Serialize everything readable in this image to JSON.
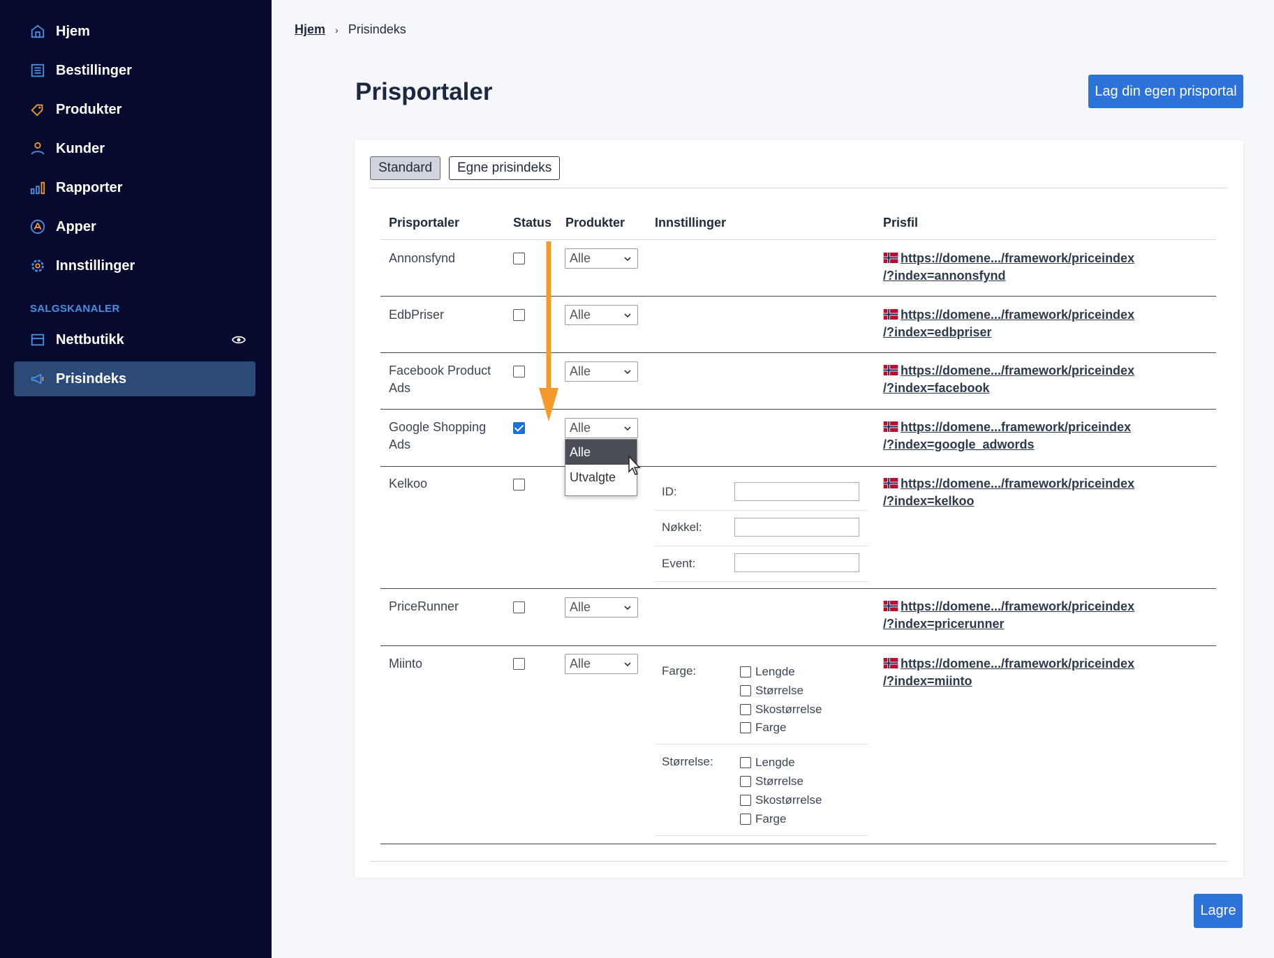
{
  "sidebar": {
    "items": [
      {
        "label": "Hjem",
        "icon": "home-icon"
      },
      {
        "label": "Bestillinger",
        "icon": "orders-icon"
      },
      {
        "label": "Produkter",
        "icon": "tag-icon"
      },
      {
        "label": "Kunder",
        "icon": "user-icon"
      },
      {
        "label": "Rapporter",
        "icon": "bar-chart-icon"
      },
      {
        "label": "Apper",
        "icon": "apps-icon"
      },
      {
        "label": "Innstillinger",
        "icon": "gear-icon"
      }
    ],
    "section_label": "SALGSKANALER",
    "channels": [
      {
        "label": "Nettbutikk",
        "icon": "store-icon"
      },
      {
        "label": "Prisindeks",
        "icon": "megaphone-icon"
      }
    ]
  },
  "breadcrumb": {
    "home": "Hjem",
    "current": "Prisindeks"
  },
  "page": {
    "title": "Prisportaler",
    "create_button": "Lag din egen prisportal",
    "save_button": "Lagre"
  },
  "tabs": {
    "standard": "Standard",
    "custom": "Egne prisindeks"
  },
  "table": {
    "headers": {
      "portal": "Prisportaler",
      "status": "Status",
      "products": "Produkter",
      "settings": "Innstillinger",
      "pricefile": "Prisfil"
    },
    "rows": [
      {
        "name": "Annonsfynd",
        "checked": false,
        "select": "Alle",
        "link1": "https://domene.../framework/priceindex",
        "link2": "/?index=annonsfynd"
      },
      {
        "name": "EdbPriser",
        "checked": false,
        "select": "Alle",
        "link1": "https://domene.../framework/priceindex",
        "link2": "/?index=edbpriser"
      },
      {
        "name": "Facebook Product Ads",
        "checked": false,
        "select": "Alle",
        "link1": "https://domene.../framework/priceindex",
        "link2": "/?index=facebook"
      },
      {
        "name": "Google Shopping Ads",
        "checked": true,
        "select": "Alle",
        "link1": "https://domene...framework/priceindex",
        "link2": "/?index=google_adwords"
      },
      {
        "name": "Kelkoo",
        "checked": false,
        "select": "",
        "link1": "https://domene.../framework/priceindex",
        "link2": "/?index=kelkoo"
      },
      {
        "name": "PriceRunner",
        "checked": false,
        "select": "Alle",
        "link1": "https://domene.../framework/priceindex",
        "link2": "/?index=pricerunner"
      },
      {
        "name": "Miinto",
        "checked": false,
        "select": "Alle",
        "link1": "https://domene.../framework/priceindex",
        "link2": "/?index=miinto"
      }
    ],
    "kelkoo_settings": {
      "id": "ID:",
      "key": "Nøkkel:",
      "event": "Event:"
    },
    "miinto_settings": {
      "color_label": "Farge:",
      "size_label": "Størrelse:",
      "options": [
        "Lengde",
        "Størrelse",
        "Skostørrelse",
        "Farge"
      ]
    }
  },
  "dropdown": {
    "options": [
      "Alle",
      "Utvalgte"
    ],
    "highlighted": "Alle"
  },
  "colors": {
    "sidebar": "#050a2e",
    "active": "#2b4a78",
    "primary": "#2d72d9",
    "arrow": "#f39a2b",
    "section": "#4a90e2"
  }
}
